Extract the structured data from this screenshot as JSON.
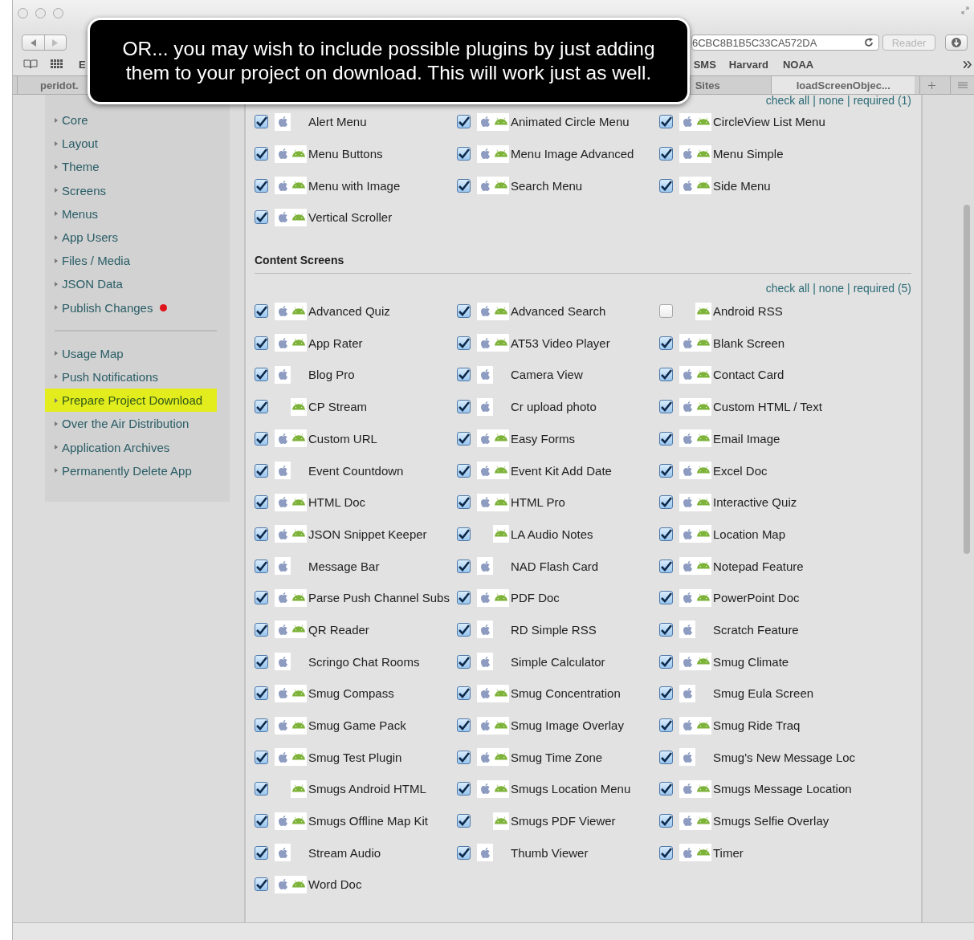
{
  "browser": {
    "address": "6CBC8B1B5C33CA572DA",
    "reader": "Reader",
    "bookmarks": [
      "E",
      "SMS",
      "Harvard",
      "NOAA"
    ],
    "tabs": [
      {
        "label": "peridot.",
        "selected": false
      },
      {
        "label": "Sites",
        "selected": false
      },
      {
        "label": "loadScreenObjec...",
        "selected": true
      }
    ]
  },
  "callout": {
    "lines": [
      "OR...  you may wish to include possible plugins by just adding",
      "them to your project on download.  This will work just as well."
    ]
  },
  "sidebar": {
    "groups": [
      [
        {
          "label": "Core",
          "selected": false,
          "alert": false
        },
        {
          "label": "Layout",
          "selected": false,
          "alert": false
        },
        {
          "label": "Theme",
          "selected": false,
          "alert": false
        },
        {
          "label": "Screens",
          "selected": false,
          "alert": false
        },
        {
          "label": "Menus",
          "selected": false,
          "alert": false
        },
        {
          "label": "App Users",
          "selected": false,
          "alert": false
        },
        {
          "label": "Files / Media",
          "selected": false,
          "alert": false
        },
        {
          "label": "JSON Data",
          "selected": false,
          "alert": false
        },
        {
          "label": "Publish Changes",
          "selected": false,
          "alert": true
        }
      ],
      [
        {
          "label": "Usage Map",
          "selected": false,
          "alert": false
        },
        {
          "label": "Push Notifications",
          "selected": false,
          "alert": false
        },
        {
          "label": "Prepare Project Download",
          "selected": true,
          "alert": false
        },
        {
          "label": "Over the Air Distribution",
          "selected": false,
          "alert": false
        },
        {
          "label": "Application Archives",
          "selected": false,
          "alert": false
        },
        {
          "label": "Permanently Delete App",
          "selected": false,
          "alert": false
        }
      ]
    ]
  },
  "sections": [
    {
      "links": [
        "check all",
        "none",
        "required (1)"
      ],
      "separator": "|",
      "plugins": [
        {
          "name": "Alert Menu",
          "checked": true,
          "ios": true,
          "android": false
        },
        {
          "name": "Animated Circle Menu",
          "checked": true,
          "ios": true,
          "android": true
        },
        {
          "name": "CircleView List Menu",
          "checked": true,
          "ios": true,
          "android": true
        },
        {
          "name": "Menu Buttons",
          "checked": true,
          "ios": true,
          "android": true
        },
        {
          "name": "Menu Image Advanced",
          "checked": true,
          "ios": true,
          "android": true
        },
        {
          "name": "Menu Simple",
          "checked": true,
          "ios": true,
          "android": true
        },
        {
          "name": "Menu with Image",
          "checked": true,
          "ios": true,
          "android": true
        },
        {
          "name": "Search Menu",
          "checked": true,
          "ios": true,
          "android": true
        },
        {
          "name": "Side Menu",
          "checked": true,
          "ios": true,
          "android": true
        },
        {
          "name": "Vertical Scroller",
          "checked": true,
          "ios": true,
          "android": true
        }
      ]
    },
    {
      "title": "Content Screens",
      "links": [
        "check all",
        "none",
        "required (5)"
      ],
      "separator": "|",
      "plugins": [
        {
          "name": "Advanced Quiz",
          "checked": true,
          "ios": true,
          "android": true
        },
        {
          "name": "Advanced Search",
          "checked": true,
          "ios": true,
          "android": true
        },
        {
          "name": "Android RSS",
          "checked": false,
          "ios": false,
          "android": true
        },
        {
          "name": "App Rater",
          "checked": true,
          "ios": true,
          "android": true
        },
        {
          "name": "AT53 Video Player",
          "checked": true,
          "ios": true,
          "android": true
        },
        {
          "name": "Blank Screen",
          "checked": true,
          "ios": true,
          "android": true
        },
        {
          "name": "Blog Pro",
          "checked": true,
          "ios": true,
          "android": false
        },
        {
          "name": "Camera View",
          "checked": true,
          "ios": true,
          "android": false
        },
        {
          "name": "Contact Card",
          "checked": true,
          "ios": true,
          "android": true
        },
        {
          "name": "CP Stream",
          "checked": true,
          "ios": false,
          "android": true
        },
        {
          "name": "Cr upload photo",
          "checked": true,
          "ios": true,
          "android": false
        },
        {
          "name": "Custom HTML / Text",
          "checked": true,
          "ios": true,
          "android": true
        },
        {
          "name": "Custom URL",
          "checked": true,
          "ios": true,
          "android": true
        },
        {
          "name": "Easy Forms",
          "checked": true,
          "ios": true,
          "android": true
        },
        {
          "name": "Email Image",
          "checked": true,
          "ios": true,
          "android": true
        },
        {
          "name": "Event Countdown",
          "checked": true,
          "ios": true,
          "android": false
        },
        {
          "name": "Event Kit Add Date",
          "checked": true,
          "ios": true,
          "android": true
        },
        {
          "name": "Excel Doc",
          "checked": true,
          "ios": true,
          "android": true
        },
        {
          "name": "HTML Doc",
          "checked": true,
          "ios": true,
          "android": true
        },
        {
          "name": "HTML Pro",
          "checked": true,
          "ios": true,
          "android": true
        },
        {
          "name": "Interactive Quiz",
          "checked": true,
          "ios": true,
          "android": true
        },
        {
          "name": "JSON Snippet Keeper",
          "checked": true,
          "ios": true,
          "android": true
        },
        {
          "name": "LA Audio Notes",
          "checked": true,
          "ios": false,
          "android": true
        },
        {
          "name": "Location Map",
          "checked": true,
          "ios": true,
          "android": true
        },
        {
          "name": "Message Bar",
          "checked": true,
          "ios": true,
          "android": false
        },
        {
          "name": "NAD Flash Card",
          "checked": true,
          "ios": true,
          "android": false
        },
        {
          "name": "Notepad Feature",
          "checked": true,
          "ios": true,
          "android": true
        },
        {
          "name": "Parse Push Channel Subs",
          "checked": true,
          "ios": true,
          "android": true
        },
        {
          "name": "PDF Doc",
          "checked": true,
          "ios": true,
          "android": true
        },
        {
          "name": "PowerPoint Doc",
          "checked": true,
          "ios": true,
          "android": true
        },
        {
          "name": "QR Reader",
          "checked": true,
          "ios": true,
          "android": true
        },
        {
          "name": "RD Simple RSS",
          "checked": true,
          "ios": true,
          "android": false
        },
        {
          "name": "Scratch Feature",
          "checked": true,
          "ios": true,
          "android": false
        },
        {
          "name": "Scringo Chat Rooms",
          "checked": true,
          "ios": true,
          "android": false
        },
        {
          "name": "Simple Calculator",
          "checked": true,
          "ios": true,
          "android": false
        },
        {
          "name": "Smug Climate",
          "checked": true,
          "ios": true,
          "android": true
        },
        {
          "name": "Smug Compass",
          "checked": true,
          "ios": true,
          "android": true
        },
        {
          "name": "Smug Concentration",
          "checked": true,
          "ios": true,
          "android": true
        },
        {
          "name": "Smug Eula Screen",
          "checked": true,
          "ios": true,
          "android": false
        },
        {
          "name": "Smug Game Pack",
          "checked": true,
          "ios": true,
          "android": true
        },
        {
          "name": "Smug Image Overlay",
          "checked": true,
          "ios": true,
          "android": true
        },
        {
          "name": "Smug Ride Traq",
          "checked": true,
          "ios": true,
          "android": true
        },
        {
          "name": "Smug Test Plugin",
          "checked": true,
          "ios": true,
          "android": true
        },
        {
          "name": "Smug Time Zone",
          "checked": true,
          "ios": true,
          "android": true
        },
        {
          "name": "Smug's New Message Loc",
          "checked": true,
          "ios": true,
          "android": false
        },
        {
          "name": "Smugs Android HTML",
          "checked": true,
          "ios": false,
          "android": true
        },
        {
          "name": "Smugs Location Menu",
          "checked": true,
          "ios": true,
          "android": true
        },
        {
          "name": "Smugs Message Location",
          "checked": true,
          "ios": true,
          "android": true
        },
        {
          "name": "Smugs Offline Map Kit",
          "checked": true,
          "ios": true,
          "android": true
        },
        {
          "name": "Smugs PDF Viewer",
          "checked": true,
          "ios": false,
          "android": true
        },
        {
          "name": "Smugs Selfie Overlay",
          "checked": true,
          "ios": true,
          "android": true
        },
        {
          "name": "Stream Audio",
          "checked": true,
          "ios": true,
          "android": false
        },
        {
          "name": "Thumb Viewer",
          "checked": true,
          "ios": true,
          "android": false
        },
        {
          "name": "Timer",
          "checked": true,
          "ios": true,
          "android": true
        },
        {
          "name": "Word Doc",
          "checked": true,
          "ios": true,
          "android": true
        }
      ]
    }
  ]
}
